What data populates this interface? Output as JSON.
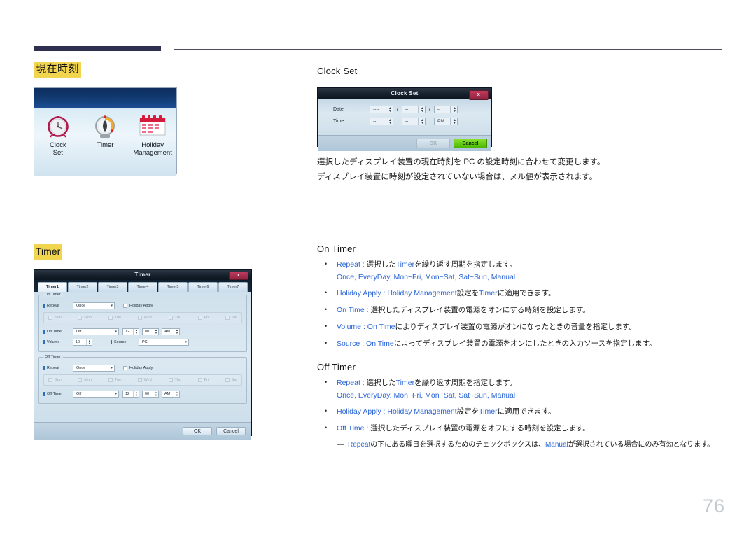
{
  "page": {
    "number": "76"
  },
  "colors": {
    "highlight": "#f2d54e",
    "link_blue": "#2b66d6",
    "header_bar": "#2f2f52",
    "page_number": "#c3c8cd"
  },
  "sections": {
    "clock": {
      "heading": "現在時刻"
    },
    "timer": {
      "heading": "Timer"
    }
  },
  "icon_panel": {
    "items": [
      {
        "icon": "alarm-clock-icon",
        "line1": "Clock",
        "line2": "Set"
      },
      {
        "icon": "kitchen-timer-icon",
        "line1": "Timer",
        "line2": ""
      },
      {
        "icon": "calendar-icon",
        "line1": "Holiday",
        "line2": "Management"
      }
    ]
  },
  "clock_set_dialog": {
    "title": "Clock Set",
    "close_label": "x",
    "rows": [
      {
        "label": "Date",
        "fields": [
          {
            "value": "----"
          },
          {
            "value": "--"
          },
          {
            "value": "--"
          }
        ],
        "separators": [
          "/",
          "/"
        ]
      },
      {
        "label": "Time",
        "fields": [
          {
            "value": "--"
          },
          {
            "value": "--"
          },
          {
            "value": "PM"
          }
        ],
        "separators": [
          ":",
          ""
        ]
      }
    ],
    "buttons": {
      "ok": "OK",
      "cancel": "Cancel"
    }
  },
  "timer_dialog": {
    "title": "Timer",
    "close_label": "x",
    "tabs": [
      "Timer1",
      "Timer2",
      "Timer3",
      "Timer4",
      "Timer5",
      "Timer6",
      "Timer7"
    ],
    "on_timer": {
      "group_title": "On Timer",
      "repeat_label": "Repeat",
      "repeat_value": "Once",
      "holiday_apply_label": "Holiday Apply",
      "days": [
        "Sun",
        "Mon",
        "Tue",
        "Wed",
        "Thu",
        "Fri",
        "Sat"
      ],
      "time_label": "On Time",
      "time_mode": "Off",
      "hour": "12",
      "minute": "00",
      "meridiem": "AM",
      "volume_label": "Volume",
      "volume_value": "10",
      "source_label": "Source",
      "source_value": "PC"
    },
    "off_timer": {
      "group_title": "Off Timer",
      "repeat_label": "Repeat",
      "repeat_value": "Once",
      "holiday_apply_label": "Holiday Apply",
      "days": [
        "Sun",
        "Mon",
        "Tue",
        "Wed",
        "Thu",
        "Fri",
        "Sat"
      ],
      "time_label": "Off Time",
      "time_mode": "Off",
      "hour": "12",
      "minute": "00",
      "meridiem": "AM"
    },
    "buttons": {
      "ok": "OK",
      "cancel": "Cancel"
    }
  },
  "right": {
    "clock_set": {
      "title": "Clock Set",
      "paragraphs": [
        "選択したディスプレイ装置の現在時刻を PC の設定時刻に合わせて変更します。",
        "ディスプレイ装置に時刻が設定されていない場合は、ヌル値が表示されます。"
      ]
    },
    "on_timer": {
      "title": "On Timer",
      "bullets": [
        {
          "key": "Repeat",
          "sep": " : ",
          "jp": "選択した",
          "kw2": "Timer",
          "jp2": "を繰り返す周期を指定します。",
          "sub": "Once, EveryDay, Mon~Fri, Mon~Sat, Sat~Sun, Manual"
        },
        {
          "key": "Holiday Apply",
          "sep": " : ",
          "kw_lead": "Holiday Management",
          "jp": "設定を",
          "kw2": "Timer",
          "jp2": "に適用できます。"
        },
        {
          "key": "On Time",
          "sep": " : ",
          "jp": "選択したディスプレイ装置の電源をオンにする時刻を設定します。"
        },
        {
          "key": "Volume",
          "sep": " : ",
          "kw_lead": "On Time",
          "jp": "によりディスプレイ装置の電源がオンになったときの音量を指定します。"
        },
        {
          "key": "Source",
          "sep": " : ",
          "kw_lead": "On Time",
          "jp": "によってディスプレイ装置の電源をオンにしたときの入力ソースを指定します。"
        }
      ]
    },
    "off_timer": {
      "title": "Off Timer",
      "bullets": [
        {
          "key": "Repeat",
          "sep": " : ",
          "jp": "選択した",
          "kw2": "Timer",
          "jp2": "を繰り返す周期を指定します。",
          "sub": "Once, EveryDay, Mon~Fri, Mon~Sat, Sat~Sun, Manual"
        },
        {
          "key": "Holiday Apply",
          "sep": " : ",
          "kw_lead": "Holiday Management",
          "jp": "設定を",
          "kw2": "Timer",
          "jp2": "に適用できます。"
        },
        {
          "key": "Off Time",
          "sep": " : ",
          "jp": "選択したディスプレイ装置の電源をオフにする時刻を設定します。"
        }
      ],
      "note": {
        "kw1": "Repeat",
        "jp1": "の下にある曜日を選択するためのチェックボックスは、",
        "kw2": "Manual",
        "jp2": "が選択されている場合にのみ有効となります。"
      }
    }
  }
}
